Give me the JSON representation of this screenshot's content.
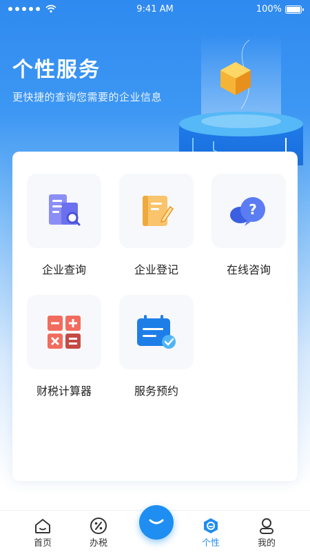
{
  "status_bar": {
    "time": "9:41 AM",
    "battery": "100%"
  },
  "header": {
    "title": "个性服务",
    "subtitle": "更快捷的查询您需要的企业信息"
  },
  "services": [
    {
      "label": "企业查询",
      "icon": "company-search-icon"
    },
    {
      "label": "企业登记",
      "icon": "registration-icon"
    },
    {
      "label": "在线咨询",
      "icon": "consult-chat-icon"
    },
    {
      "label": "财税计算器",
      "icon": "calculator-icon"
    },
    {
      "label": "服务预约",
      "icon": "calendar-check-icon"
    }
  ],
  "tabbar": {
    "items": [
      {
        "label": "首页",
        "icon": "home-icon"
      },
      {
        "label": "办税",
        "icon": "tax-percent-icon"
      },
      {
        "label": "个性",
        "icon": "personal-icon",
        "active": true
      },
      {
        "label": "我的",
        "icon": "user-icon"
      }
    ],
    "center_icon": "smile-icon"
  },
  "colors": {
    "primary": "#1e8ef2",
    "header_blue": "#2f8af0"
  }
}
